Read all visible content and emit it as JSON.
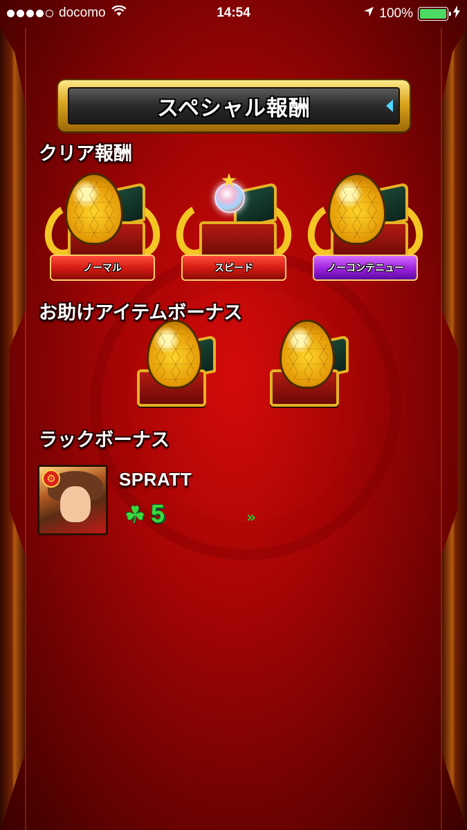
{
  "status_bar": {
    "carrier": "docomo",
    "time": "14:54",
    "battery": "100%"
  },
  "title": "スペシャル報酬",
  "clear_reward": {
    "heading": "クリア報酬",
    "items": [
      {
        "label": "ノーマル",
        "reward": "egg",
        "ribbon_color": "#d01a12"
      },
      {
        "label": "スピード",
        "reward": "orb",
        "ribbon_color": "#d01a12"
      },
      {
        "label": "ノーコンテニュー",
        "reward": "egg",
        "ribbon_color": "#9c22dc"
      }
    ]
  },
  "helper_bonus": {
    "heading": "お助けアイテムボーナス",
    "items": [
      {
        "reward": "egg"
      },
      {
        "reward": "egg"
      }
    ]
  },
  "luck_bonus": {
    "heading": "ラックボーナス",
    "player_name": "SPRATT",
    "luck_icon": "clover-icon",
    "luck_value": "5",
    "arrows": "»"
  },
  "colors": {
    "background": "#b00606",
    "gold": "#e5b224",
    "luck_green": "#3ed83a"
  }
}
